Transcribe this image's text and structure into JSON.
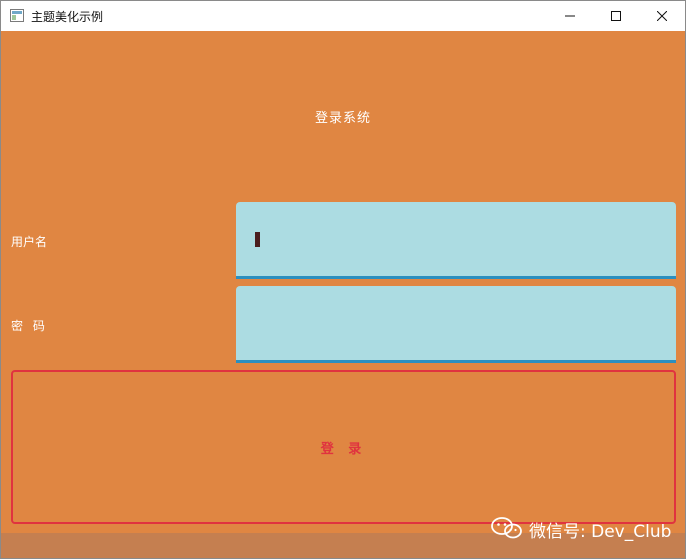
{
  "window": {
    "title": "主题美化示例",
    "icon": "app-window-icon"
  },
  "titlebar": {
    "minimize_icon": "minimize-icon",
    "maximize_icon": "maximize-icon",
    "close_icon": "close-icon"
  },
  "form": {
    "heading": "登录系统",
    "username_label": "用户名",
    "username_value": "",
    "password_label": "密 码",
    "password_value": "",
    "login_button": "登 录"
  },
  "watermark": {
    "text": "微信号: Dev_Club",
    "icon": "wechat-logo-icon"
  },
  "colors": {
    "background": "#e08642",
    "input_background": "#acdce2",
    "input_underline": "#2b8fbf",
    "button_accent": "#e0333f",
    "text": "#ffffff"
  }
}
